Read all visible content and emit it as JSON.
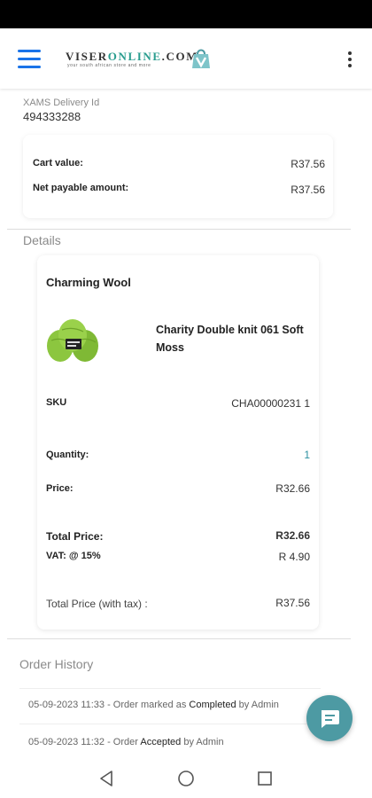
{
  "header": {
    "logo_text_main": "VISER",
    "logo_text_accent": "ONLINE",
    "logo_text_tld": ".COM",
    "logo_tagline": "your south african store and more",
    "menu_icon": "hamburger-menu-icon",
    "overflow_icon": "more-vertical-icon"
  },
  "delivery": {
    "label": "XAMS Delivery Id",
    "value": "494333288"
  },
  "summary": {
    "cart_value_label": "Cart value:",
    "cart_value": "R37.56",
    "net_payable_label": "Net payable amount:",
    "net_payable": "R37.56"
  },
  "details": {
    "section_title": "Details",
    "brand": "Charming Wool",
    "product_name": "Charity Double knit 061 Soft Moss",
    "product_image_icon": "yarn-skein-image",
    "sku_label": "SKU",
    "sku_value": "CHA00000231 1",
    "quantity_label": "Quantity:",
    "quantity_value": "1",
    "price_label": "Price:",
    "price_value": "R32.66",
    "total_price_label": "Total Price:",
    "total_price_value": "R32.66",
    "vat_label": "VAT: @ 15%",
    "vat_value": "R 4.90",
    "total_with_tax_label": "Total Price (with tax) :",
    "total_with_tax_value": "R37.56"
  },
  "order_history": {
    "section_title": "Order History",
    "entries": [
      {
        "prefix": "05-09-2023 11:33 - Order marked as ",
        "status": "Completed",
        "suffix": " by Admin"
      },
      {
        "prefix": "05-09-2023 11:32 - Order ",
        "status": "Accepted",
        "suffix": " by Admin"
      }
    ]
  },
  "chat": {
    "icon": "chat-bubble-icon"
  },
  "system_nav": {
    "back_icon": "back-triangle-icon",
    "home_icon": "home-circle-icon",
    "recents_icon": "recents-square-icon"
  },
  "colors": {
    "accent_blue": "#1a73e8",
    "teal": "#4d9aa3",
    "quantity_link": "#2a8fa0",
    "yarn_green": "#8cc63f"
  }
}
